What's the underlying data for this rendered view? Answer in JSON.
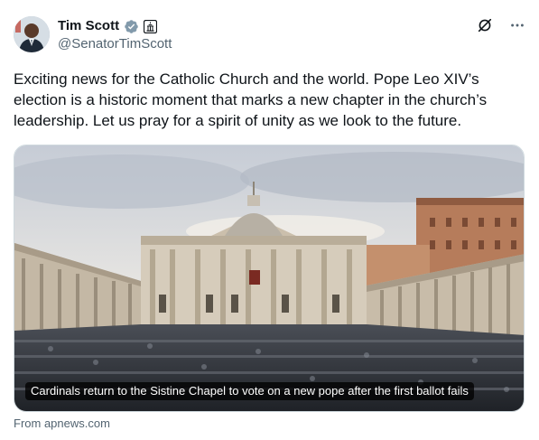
{
  "author": {
    "display_name": "Tim Scott",
    "handle": "@SenatorTimScott",
    "verified_badge_color": "#829aab",
    "affiliation_icon": "senate-building-icon"
  },
  "top_actions": {
    "grok_icon": "grok-icon",
    "more_icon": "more-icon"
  },
  "tweet": {
    "text": "Exciting news for the Catholic Church and the world. Pope Leo XIV’s election is a historic moment that marks a new chapter in the church’s leadership. Let us pray for a spirit of unity as we look to the future."
  },
  "link_card": {
    "image_alt": "St. Peter's Basilica with a crowd in the square",
    "caption": "Cardinals return to the Sistine Chapel to vote on a new pope after the first ballot fails",
    "source": "From apnews.com"
  },
  "colors": {
    "text_primary": "#0f1419",
    "text_secondary": "#536471",
    "border": "#cfd9de"
  }
}
